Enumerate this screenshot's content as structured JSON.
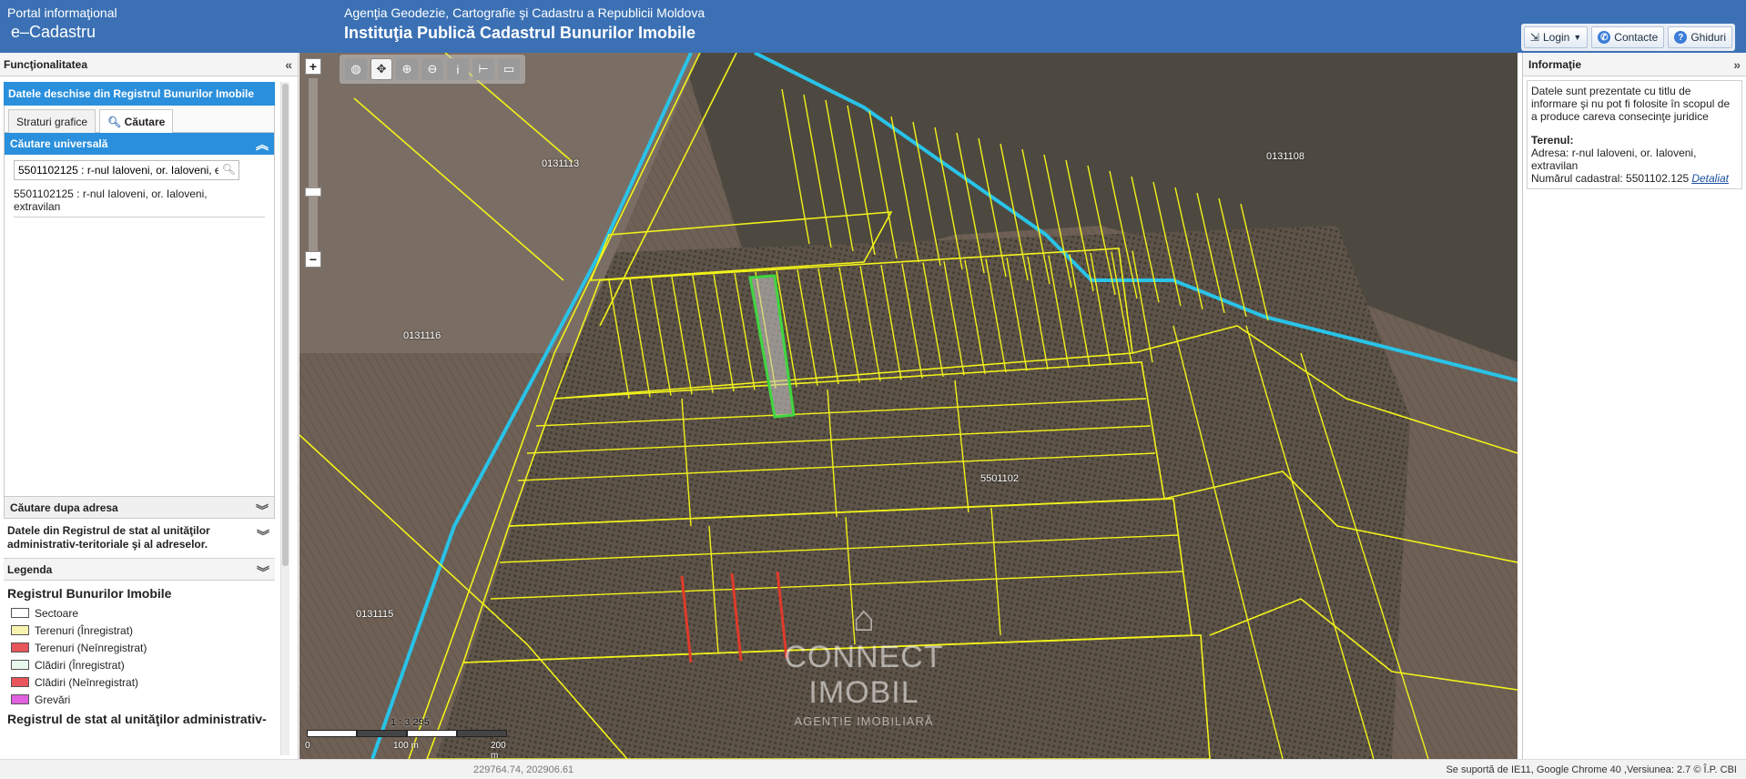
{
  "header": {
    "portal_line1": "Portal informaţional",
    "portal_line2": "e–Cadastru",
    "agency": "Agenţia Geodezie, Cartografie şi Cadastru a Republicii Moldova",
    "institution": "Instituţia Publică Cadastrul Bunurilor Imobile",
    "login": "Login",
    "contacts": "Contacte",
    "guides": "Ghiduri"
  },
  "left": {
    "title": "Funcţionalitatea",
    "open_data": "Datele deschise din Registrul Bunurilor Imobile",
    "tabs": [
      "Straturi grafice",
      "Căutare"
    ],
    "universal_search": "Căutare universală",
    "search_value": "5501102125 : r-nul Ialoveni, or. Ialoveni, extravilan",
    "result_line1": "5501102125 : r-nul Ialoveni, or. Ialoveni,",
    "result_line2": "extravilan",
    "address_search": "Căutare dupa adresa",
    "admin_register_line1": "Datele din Registrul de stat al unităţilor",
    "admin_register_line2": "administrativ-teritoriale şi al adreselor.",
    "legend": "Legenda",
    "legend_title": "Registrul Bunurilor Imobile",
    "legend_items": [
      {
        "label": "Sectoare",
        "color": "#ffffff"
      },
      {
        "label": "Terenuri (Înregistrat)",
        "color": "#f7f3b0"
      },
      {
        "label": "Terenuri (Neînregistrat)",
        "color": "#e8555a"
      },
      {
        "label": "Clădiri (Înregistrat)",
        "color": "#e8f8ec"
      },
      {
        "label": "Clădiri (Neînregistrat)",
        "color": "#e8555a"
      },
      {
        "label": "Grevări",
        "color": "#e060e0"
      }
    ],
    "legend_title2": "Registrul de stat al unităţilor administrativ-"
  },
  "map": {
    "tools": [
      "globe-icon",
      "pan-icon",
      "zoom-in-icon",
      "zoom-out-icon",
      "info-icon",
      "measure-line-icon",
      "measure-area-icon"
    ],
    "zoom_in": "+",
    "zoom_out": "−",
    "labels": {
      "p0131113": "0131113",
      "p0131116": "0131116",
      "p0131115": "0131115",
      "p0131108": "0131108",
      "p5501102": "5501102"
    },
    "scale": "1 : 3 295",
    "scale_labels": [
      "0",
      "100 m",
      "200 m"
    ],
    "watermark_brand": "CONNECT IMOBIL",
    "watermark_sub": "AGENȚIE IMOBILIARĂ"
  },
  "right": {
    "title": "Informaţie",
    "disclaimer": "Datele sunt prezentate cu titlu de informare şi nu pot fi folosite în scopul de a produce careva consecinţe juridice",
    "terrain_heading": "Terenul:",
    "address": "Adresa: r-nul Ialoveni, or. Ialoveni, extravilan",
    "cadastral": "Numărul cadastral: 5501102.125",
    "detail_link": "Detaliat"
  },
  "footer": {
    "coords": "229764.74, 202906.61",
    "version": "Se suportă de IE11, Google Chrome 40 ,Versiunea: 2.7 © Î.P. CBI"
  },
  "colors": {
    "header_bg": "#3b71b4",
    "accent_blue": "#2a8fdc",
    "parcel_line": "#f2f21a",
    "selected_parcel": "#3fd63f",
    "boundary_cyan": "#29c3e8"
  }
}
